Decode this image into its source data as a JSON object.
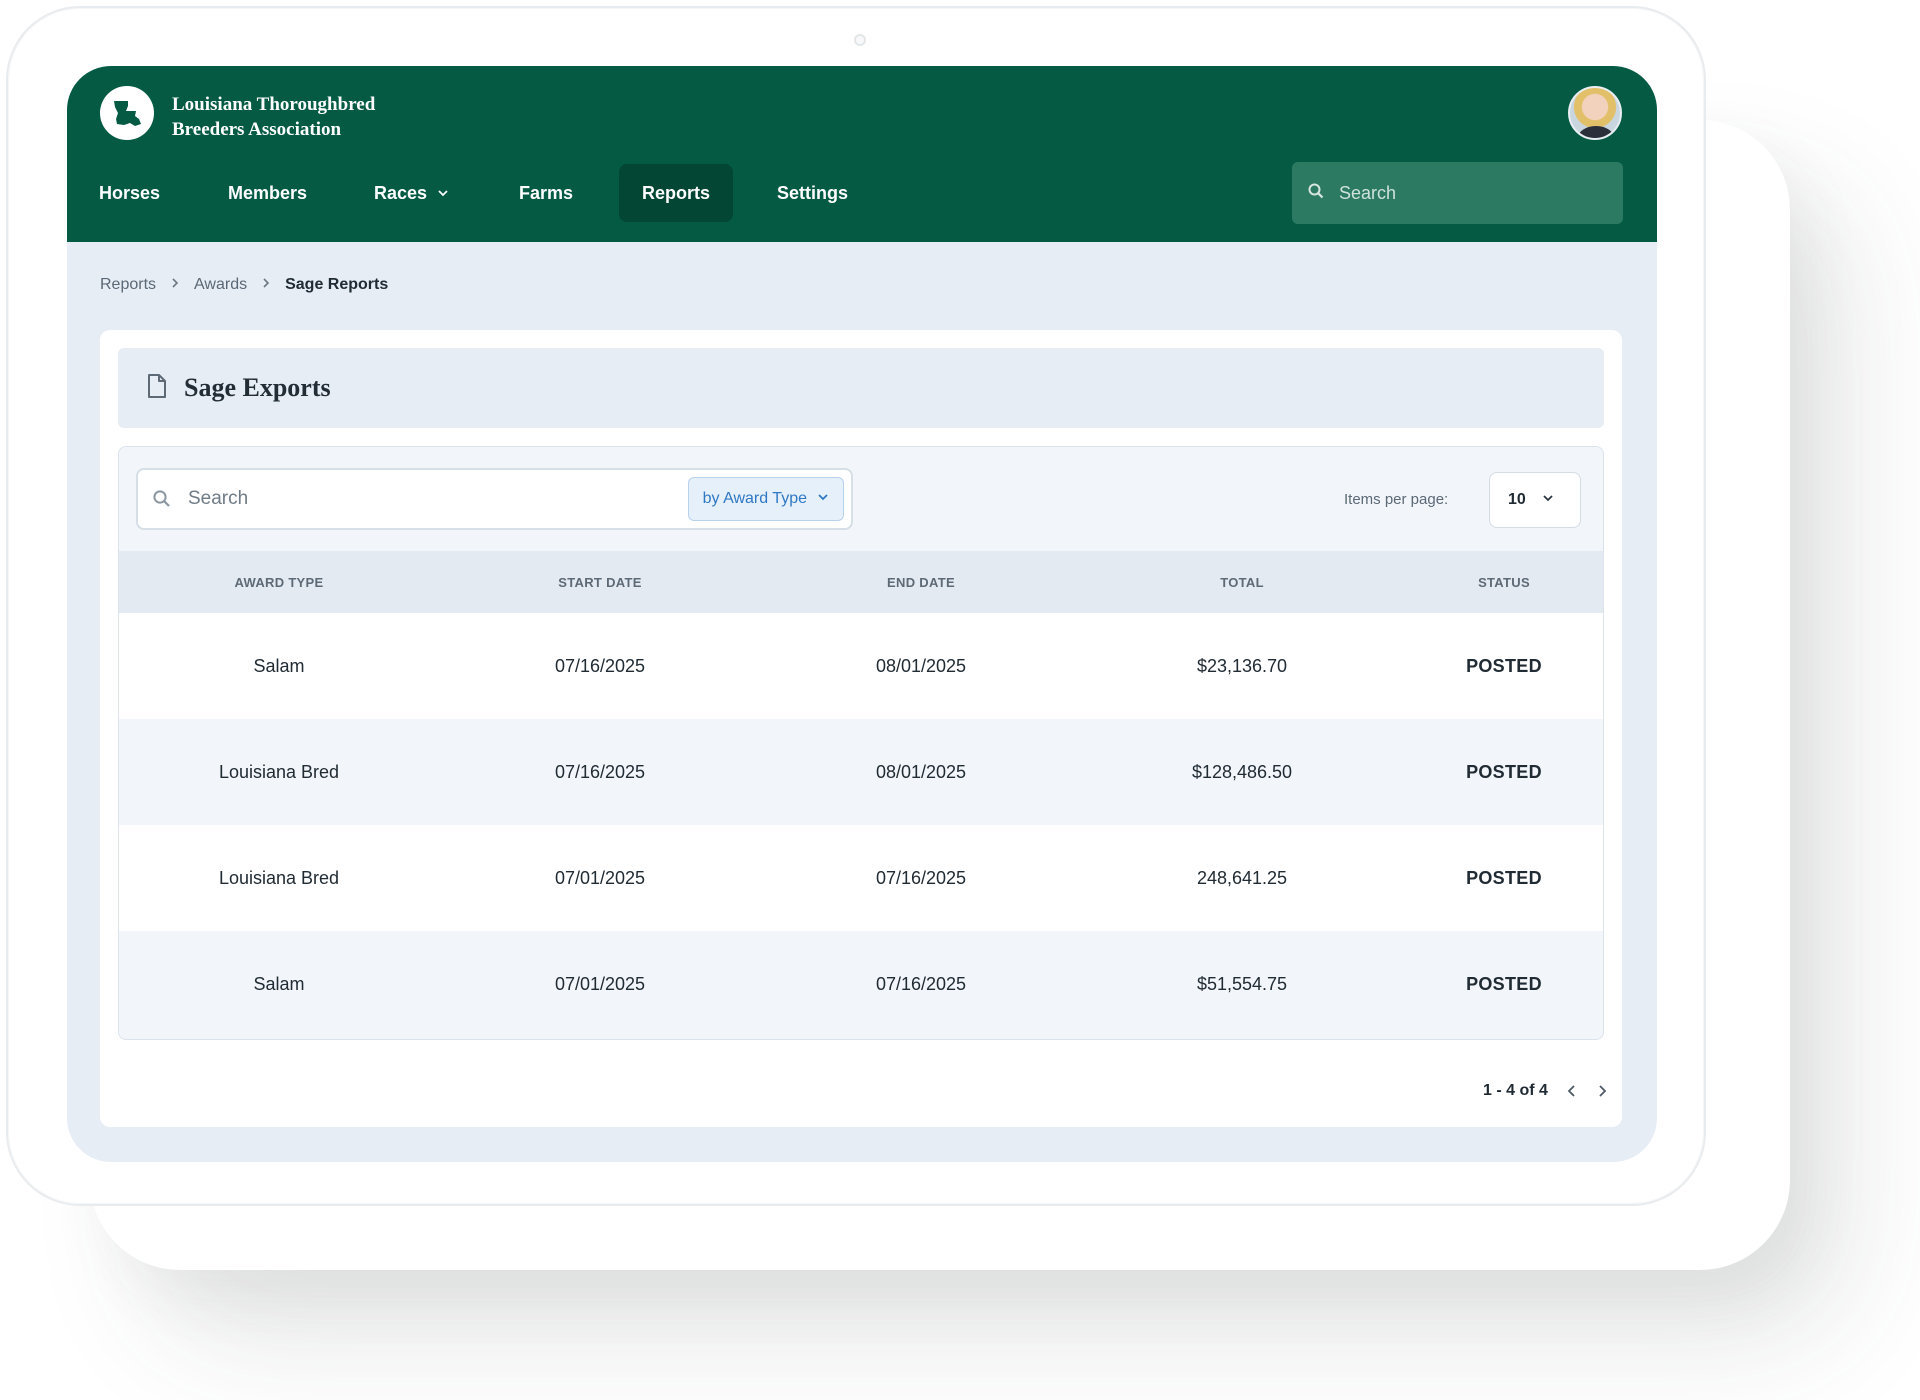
{
  "app": {
    "org_name_line1": "Louisiana Thoroughbred",
    "org_name_line2": "Breeders Association"
  },
  "nav": {
    "horses": "Horses",
    "members": "Members",
    "races": "Races",
    "farms": "Farms",
    "reports": "Reports",
    "settings": "Settings",
    "active": "Reports"
  },
  "header_search": {
    "placeholder": "Search"
  },
  "breadcrumb": {
    "items": [
      "Reports",
      "Awards"
    ],
    "current": "Sage Reports"
  },
  "card": {
    "title": "Sage Exports"
  },
  "filter": {
    "search_placeholder": "Search",
    "type_label": "by Award Type"
  },
  "pagination": {
    "items_per_page_label": "Items per page:",
    "items_per_page_value": "10",
    "range": "1 - 4 of 4"
  },
  "table": {
    "headers": [
      "AWARD TYPE",
      "START DATE",
      "END DATE",
      "TOTAL",
      "STATUS"
    ],
    "rows": [
      {
        "award_type": "Salam",
        "start": "07/16/2025",
        "end": "08/01/2025",
        "total": "$23,136.70",
        "status": "POSTED"
      },
      {
        "award_type": "Louisiana Bred",
        "start": "07/16/2025",
        "end": "08/01/2025",
        "total": "$128,486.50",
        "status": "POSTED"
      },
      {
        "award_type": "Louisiana Bred",
        "start": "07/01/2025",
        "end": "07/16/2025",
        "total": "248,641.25",
        "status": "POSTED"
      },
      {
        "award_type": "Salam",
        "start": "07/01/2025",
        "end": "07/16/2025",
        "total": "$51,554.75",
        "status": "POSTED"
      }
    ]
  },
  "colors": {
    "header_green": "#045a43",
    "active_nav": "#034633",
    "status_teal": "#16859b",
    "accent_blue": "#2f78c4"
  },
  "icons": [
    "louisiana-logo-icon",
    "search-icon",
    "chevron-down-icon",
    "document-icon",
    "chevron-right-icon",
    "chevron-left-icon"
  ]
}
